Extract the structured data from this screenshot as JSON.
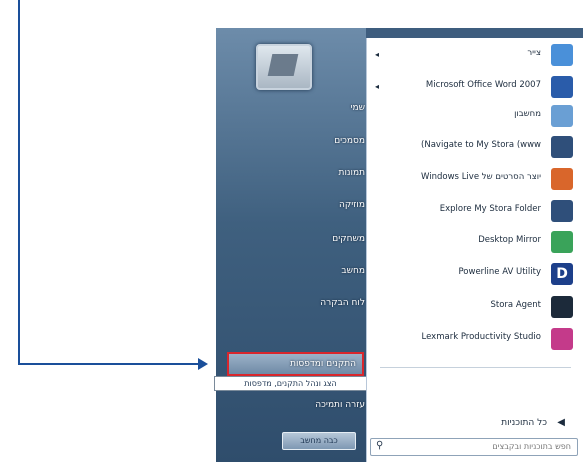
{
  "start_menu": {
    "programs": [
      {
        "label": "צייר",
        "icon": "paint-icon",
        "color": "#4a90d9",
        "has_submenu": true
      },
      {
        "label": "Microsoft Office Word 2007",
        "icon": "word-icon",
        "color": "#2a5caa",
        "has_submenu": true
      },
      {
        "label": "מחשבון",
        "icon": "calculator-icon",
        "color": "#6a9fd4",
        "has_submenu": false
      },
      {
        "label": "(Navigate to My Stora (www",
        "icon": "stora-icon",
        "color": "#2f4f7a",
        "has_submenu": false
      },
      {
        "label": "Windows Live יוצר הסרטים של",
        "icon": "movie-maker-icon",
        "color": "#d9662b",
        "has_submenu": false
      },
      {
        "label": "Explore My Stora Folder",
        "icon": "stora-folder-icon",
        "color": "#2f4f7a",
        "has_submenu": false
      },
      {
        "label": "Desktop Mirror",
        "icon": "desktop-mirror-icon",
        "color": "#3aa35a",
        "has_submenu": false
      },
      {
        "label": "Powerline AV Utility",
        "icon": "powerline-icon",
        "color": "#1d3f8a",
        "glyph": "D",
        "has_submenu": false
      },
      {
        "label": "Stora Agent",
        "icon": "stora-agent-icon",
        "color": "#1c2a3a",
        "has_submenu": false
      },
      {
        "label": "Lexmark Productivity Studio",
        "icon": "lexmark-icon",
        "color": "#c43a8a",
        "has_submenu": false
      }
    ],
    "all_programs": "כל התוכניות",
    "search_placeholder": "חפש בתוכניות ובקבצים",
    "right_items": [
      "שמי",
      "מסמכים",
      "תמונות",
      "מוזיקה",
      "משחקים",
      "מחשב",
      "לוח הבקרה"
    ],
    "highlighted_item": "התקנים ומדפסות",
    "tooltip": "הצג ונהל התקנים, מדפסות",
    "help_item": "עזרה ותמיכה",
    "shutdown": "כבה מחשב"
  },
  "colors": {
    "callout": "#1a4f9a",
    "highlight_border": "#d9262c"
  }
}
